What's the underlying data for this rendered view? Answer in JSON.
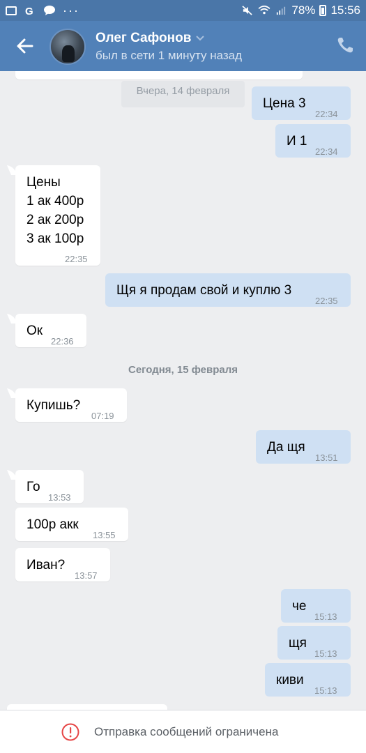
{
  "status_bar": {
    "battery": "78%",
    "time": "15:56",
    "dots": "···"
  },
  "header": {
    "name": "Олег Сафонов",
    "last_seen": "был в сети 1 минуту назад"
  },
  "chat": {
    "date_top": "Вчера, 14 февраля",
    "date_today": "Сегодня, 15 февраля",
    "messages": [
      {
        "dir": "out",
        "text": "Цена 3",
        "time": "22:34"
      },
      {
        "dir": "out",
        "text": "И 1",
        "time": "22:34"
      },
      {
        "dir": "in",
        "text": "Цены\n1 ак 400р\n2 ак 200р\n3 ак 100р",
        "time": "22:35"
      },
      {
        "dir": "out",
        "text": "Щя я продам свой и куплю 3",
        "time": "22:35"
      },
      {
        "dir": "in",
        "text": "Ок",
        "time": "22:36"
      },
      {
        "dir": "in",
        "text": "Купишь?",
        "time": "07:19"
      },
      {
        "dir": "out",
        "text": "Да щя",
        "time": "13:51"
      },
      {
        "dir": "in",
        "text": "Го",
        "time": "13:53"
      },
      {
        "dir": "in",
        "text": "100р акк",
        "time": "13:55"
      },
      {
        "dir": "in",
        "text": "Иван?",
        "time": "13:57"
      },
      {
        "dir": "out",
        "text": "че",
        "time": "15:13"
      },
      {
        "dir": "out",
        "text": "щя",
        "time": "15:13"
      },
      {
        "dir": "out",
        "text": "киви",
        "time": "15:13"
      }
    ]
  },
  "footer": {
    "notice": "Отправка сообщений ограничена"
  },
  "colors": {
    "header": "#5181b8",
    "statusbar": "#4a76a8",
    "outgoing": "#cfe0f3",
    "incoming": "#ffffff",
    "background": "#edeef0",
    "warning": "#e64646"
  }
}
